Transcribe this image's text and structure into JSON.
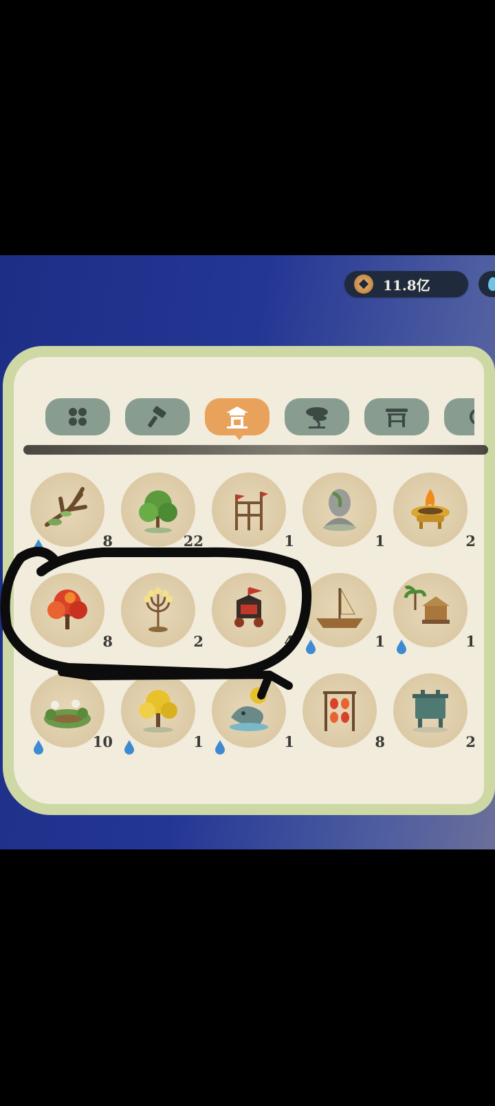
{
  "currency": {
    "amount": "11.8亿",
    "icon": "copper-coin-icon"
  },
  "tabs": [
    {
      "name": "all-categories-icon",
      "active": false
    },
    {
      "name": "hammer-icon",
      "active": false
    },
    {
      "name": "shrine-icon",
      "active": true
    },
    {
      "name": "bonsai-tree-icon",
      "active": false
    },
    {
      "name": "pavilion-icon",
      "active": false
    },
    {
      "name": "partial-tab-icon",
      "active": false
    }
  ],
  "items": [
    {
      "name": "withered-tree",
      "count": "8",
      "water": true
    },
    {
      "name": "green-bush",
      "count": "22",
      "water": false
    },
    {
      "name": "flag-frame",
      "count": "1",
      "water": false
    },
    {
      "name": "stone-statue",
      "count": "1",
      "water": false
    },
    {
      "name": "fire-brazier",
      "count": "2",
      "water": false
    },
    {
      "name": "red-maple-tree",
      "count": "8",
      "water": false
    },
    {
      "name": "lamp-stand",
      "count": "2",
      "water": false
    },
    {
      "name": "festival-cart",
      "count": "4",
      "water": false
    },
    {
      "name": "sailboat",
      "count": "1",
      "water": true
    },
    {
      "name": "palm-hut",
      "count": "1",
      "water": true
    },
    {
      "name": "lotus-pond",
      "count": "10",
      "water": true
    },
    {
      "name": "ginkgo-tree",
      "count": "1",
      "water": true
    },
    {
      "name": "whale-fountain",
      "count": "1",
      "water": true
    },
    {
      "name": "lantern-rack",
      "count": "8",
      "water": false
    },
    {
      "name": "bronze-cauldron",
      "count": "2",
      "water": false
    }
  ],
  "colors": {
    "tab_active": "#e9a25c",
    "tab_inactive": "#889c90",
    "panel": "#f1ecdc",
    "panel_border": "#cdd8a4"
  }
}
